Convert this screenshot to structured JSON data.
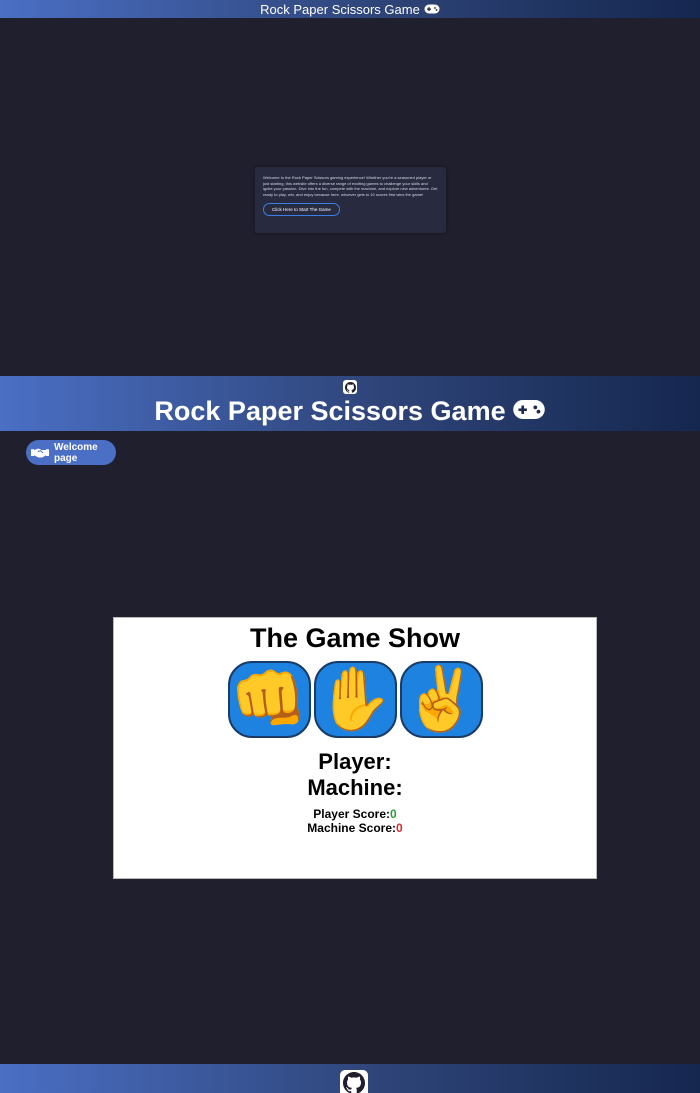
{
  "top_header": {
    "title": "Rock Paper Scissors Game",
    "icon": "gamepad-icon"
  },
  "welcome_card": {
    "text": "Welcome to the Rock Paper Scissors gaming experience! Whether you're a seasoned player or just starting, this website offers a diverse range of exciting games to challenge your skills and ignite your passion. Dive into the fun, compete with the machine, and explore new adventures. Get ready to play, win, and enjoy because here, whoever gets to 10 scores first wins the game!",
    "start_button": "Click Here to Start The Game"
  },
  "game_header": {
    "github_icon": "github-icon",
    "title": "Rock Paper Scissors Game",
    "icon": "gamepad-icon"
  },
  "welcome_page_button": {
    "label": "Welcome page",
    "icon": "handshake-icon"
  },
  "game_panel": {
    "title": "The Game Show",
    "choices": [
      {
        "name": "rock",
        "glyph": "👊"
      },
      {
        "name": "paper",
        "glyph": "✋"
      },
      {
        "name": "scissors",
        "glyph": "✌️"
      }
    ],
    "player_label": "Player:",
    "machine_label": "Machine:",
    "player_score_label": "Player Score:",
    "player_score": "0",
    "machine_score_label": "Machine Score:",
    "machine_score": "0"
  },
  "footer": {
    "github_icon": "github-icon"
  },
  "colors": {
    "background": "#1f1f2e",
    "header_gradient_start": "#4a6fc4",
    "header_gradient_end": "#15274f",
    "choice_blue": "#1e82e0",
    "score_green": "#2a9d3a",
    "score_red": "#d92b2b"
  }
}
